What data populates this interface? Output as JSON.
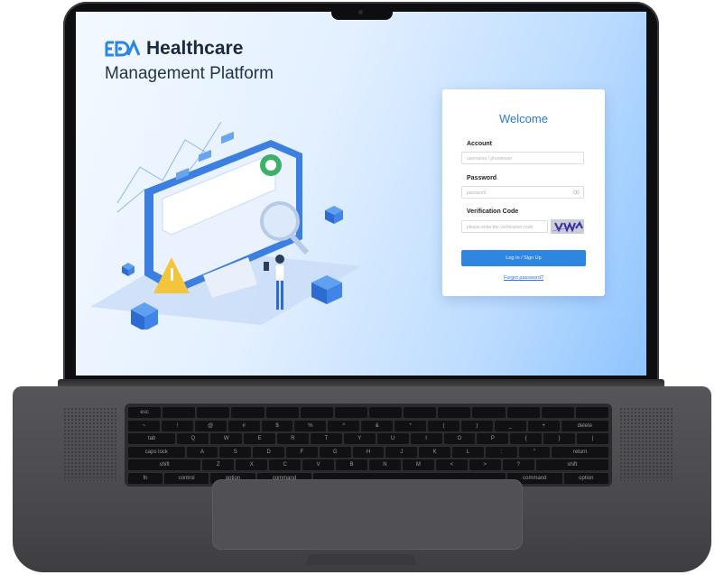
{
  "brand": {
    "name": "Healthcare",
    "subtitle": "Management Platform"
  },
  "login": {
    "title": "Welcome",
    "account_label": "Account",
    "account_placeholder": "username / phonenum",
    "password_label": "Password",
    "password_placeholder": "password",
    "verification_label": "Verification Code",
    "verification_placeholder": "please enter the verification code",
    "submit_label": "Log In / Sign Up",
    "forgot_label": "Forgot password?"
  },
  "keyboard": {
    "row0": [
      "esc",
      "",
      "",
      "",
      "",
      "",
      "",
      "",
      "",
      "",
      "",
      "",
      "",
      ""
    ],
    "row1": [
      "~",
      "!",
      "@",
      "#",
      "$",
      "%",
      "^",
      "&",
      "*",
      "(",
      ")",
      "_",
      "+",
      "delete"
    ],
    "row2": [
      "tab",
      "Q",
      "W",
      "E",
      "R",
      "T",
      "Y",
      "U",
      "I",
      "O",
      "P",
      "{",
      "}",
      "|"
    ],
    "row3": [
      "caps lock",
      "A",
      "S",
      "D",
      "F",
      "G",
      "H",
      "J",
      "K",
      "L",
      ":",
      "\"",
      "return"
    ],
    "row4": [
      "shift",
      "Z",
      "X",
      "C",
      "V",
      "B",
      "N",
      "M",
      "<",
      ">",
      "?",
      "shift"
    ],
    "row5": [
      "fn",
      "control",
      "option",
      "command",
      "",
      "command",
      "option"
    ]
  },
  "colors": {
    "accent": "#2e86e0",
    "brand_text": "#1a2a3f",
    "screen_bg": "#cfe6ff"
  }
}
